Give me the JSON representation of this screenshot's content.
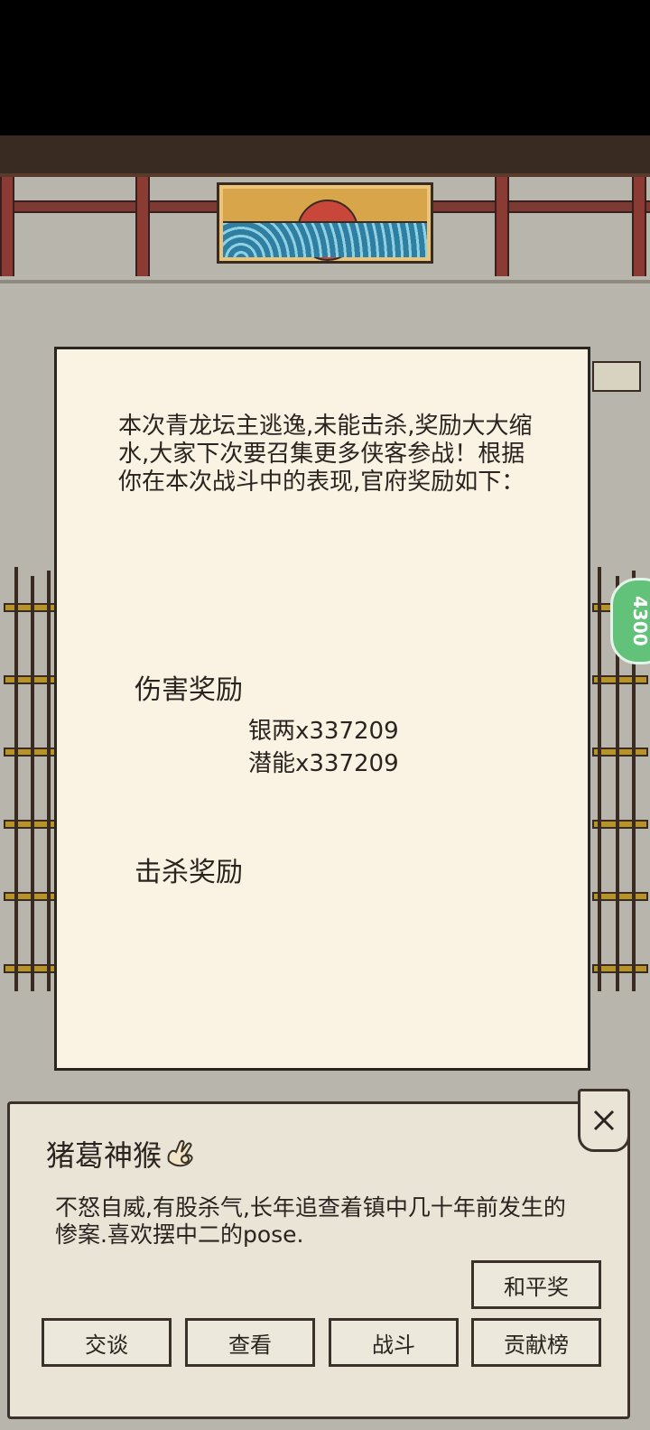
{
  "notice": {
    "intro": "本次青龙坛主逃逸,未能击杀,奖励大大缩水,大家下次要召集更多侠客参战！根据你在本次战斗中的表现,官府奖励如下：",
    "damage_title": "伤害奖励",
    "damage_rewards": [
      "银两x337209",
      "潜能x337209"
    ],
    "kill_title": "击杀奖励"
  },
  "npc": {
    "name": "猪葛神猴",
    "name_icon": "hand-gesture-icon",
    "description": "不怒自威,有股杀气,长年追查着镇中几十年前发生的惨案.喜欢摆中二的pose.",
    "peace_button": "和平奖",
    "actions": [
      "交谈",
      "查看",
      "战斗",
      "贡献榜"
    ]
  },
  "side_badge": "4300",
  "colors": {
    "paper": "#faf3e3",
    "panel": "#e9e4d6",
    "ink": "#2a2420",
    "badge": "#63c27a"
  }
}
